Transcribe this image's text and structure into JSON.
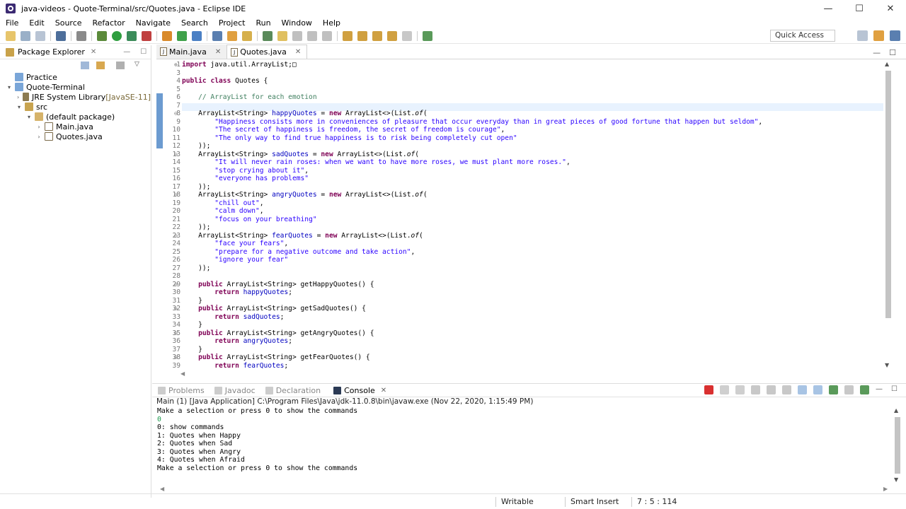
{
  "window": {
    "title": "java-videos - Quote-Terminal/src/Quotes.java - Eclipse IDE",
    "minimize": "—",
    "maximize": "☐",
    "close": "✕"
  },
  "menu": [
    "File",
    "Edit",
    "Source",
    "Refactor",
    "Navigate",
    "Search",
    "Project",
    "Run",
    "Window",
    "Help"
  ],
  "quick_access": "Quick Access",
  "package_explorer": {
    "tab": "Package Explorer",
    "tree": [
      {
        "label": "Practice",
        "indent": 0,
        "icon": "project-icon",
        "arrow": ""
      },
      {
        "label": "Quote-Terminal",
        "indent": 0,
        "icon": "project-icon",
        "arrow": "▾"
      },
      {
        "label": "JRE System Library ",
        "suffix": "[JavaSE-11]",
        "indent": 1,
        "icon": "library-icon",
        "arrow": "›"
      },
      {
        "label": "src",
        "indent": 1,
        "icon": "source-folder-icon",
        "arrow": "▾"
      },
      {
        "label": "(default package)",
        "indent": 2,
        "icon": "package-icon",
        "arrow": "▾"
      },
      {
        "label": "Main.java",
        "indent": 3,
        "icon": "java-file-icon",
        "arrow": "›"
      },
      {
        "label": "Quotes.java",
        "indent": 3,
        "icon": "java-file-icon",
        "arrow": "›"
      }
    ]
  },
  "editor": {
    "tabs": [
      {
        "label": "Main.java",
        "active": false
      },
      {
        "label": "Quotes.java",
        "active": true
      }
    ],
    "lines": [
      {
        "n": "1",
        "fold": "⊕",
        "html": "<span class=\"kw\">import</span> java.util.ArrayList;&#9633;"
      },
      {
        "n": "3",
        "fold": "",
        "html": ""
      },
      {
        "n": "4",
        "fold": "",
        "html": "<span class=\"kw\">public</span> <span class=\"kw\">class</span> Quotes {"
      },
      {
        "n": "5",
        "fold": "",
        "html": ""
      },
      {
        "n": "6",
        "fold": "",
        "html": "    <span class=\"cm\">// ArrayList for each emotion</span>"
      },
      {
        "n": "7",
        "fold": "",
        "html": ""
      },
      {
        "n": "8",
        "fold": "⊖",
        "html": "    ArrayList&lt;String&gt; <span class=\"fld\">happyQuotes</span> = <span class=\"kw\">new</span> ArrayList&lt;&gt;(List.<span class=\"ital\">of</span>("
      },
      {
        "n": "9",
        "fold": "",
        "html": "        <span class=\"str\">\"Happiness consists more in conveniences of pleasure that occur everyday than in great pieces of good fortune that happen but seldom\"</span>,"
      },
      {
        "n": "10",
        "fold": "",
        "html": "        <span class=\"str\">\"The secret of happiness is freedom, the secret of freedom is courage\"</span>,"
      },
      {
        "n": "11",
        "fold": "",
        "html": "        <span class=\"str\">\"The only way to find true happiness is to risk being completely cut open\"</span>"
      },
      {
        "n": "12",
        "fold": "",
        "html": "    ));"
      },
      {
        "n": "13",
        "fold": "⊖",
        "html": "    ArrayList&lt;String&gt; <span class=\"fld\">sadQuotes</span> = <span class=\"kw\">new</span> ArrayList&lt;&gt;(List.<span class=\"ital\">of</span>("
      },
      {
        "n": "14",
        "fold": "",
        "html": "        <span class=\"str\">\"It will never rain roses: when we want to have more roses, we must plant more roses.\"</span>,"
      },
      {
        "n": "15",
        "fold": "",
        "html": "        <span class=\"str\">\"stop crying about it\"</span>,"
      },
      {
        "n": "16",
        "fold": "",
        "html": "        <span class=\"str\">\"everyone has problems\"</span>"
      },
      {
        "n": "17",
        "fold": "",
        "html": "    ));"
      },
      {
        "n": "18",
        "fold": "⊖",
        "html": "    ArrayList&lt;String&gt; <span class=\"fld\">angryQuotes</span> = <span class=\"kw\">new</span> ArrayList&lt;&gt;(List.<span class=\"ital\">of</span>("
      },
      {
        "n": "19",
        "fold": "",
        "html": "        <span class=\"str\">\"chill out\"</span>,"
      },
      {
        "n": "20",
        "fold": "",
        "html": "        <span class=\"str\">\"calm down\"</span>,"
      },
      {
        "n": "21",
        "fold": "",
        "html": "        <span class=\"str\">\"focus on your breathing\"</span>"
      },
      {
        "n": "22",
        "fold": "",
        "html": "    ));"
      },
      {
        "n": "23",
        "fold": "⊖",
        "html": "    ArrayList&lt;String&gt; <span class=\"fld\">fearQuotes</span> = <span class=\"kw\">new</span> ArrayList&lt;&gt;(List.<span class=\"ital\">of</span>("
      },
      {
        "n": "24",
        "fold": "",
        "html": "        <span class=\"str\">\"face your fears\"</span>,"
      },
      {
        "n": "25",
        "fold": "",
        "html": "        <span class=\"str\">\"prepare for a negative outcome and take action\"</span>,"
      },
      {
        "n": "26",
        "fold": "",
        "html": "        <span class=\"str\">\"ignore your fear\"</span>"
      },
      {
        "n": "27",
        "fold": "",
        "html": "    ));"
      },
      {
        "n": "28",
        "fold": "",
        "html": ""
      },
      {
        "n": "29",
        "fold": "⊖",
        "html": "    <span class=\"kw\">public</span> ArrayList&lt;String&gt; getHappyQuotes() {"
      },
      {
        "n": "30",
        "fold": "",
        "html": "        <span class=\"kw\">return</span> <span class=\"fld\">happyQuotes</span>;"
      },
      {
        "n": "31",
        "fold": "",
        "html": "    }"
      },
      {
        "n": "32",
        "fold": "⊖",
        "html": "    <span class=\"kw\">public</span> ArrayList&lt;String&gt; getSadQuotes() {"
      },
      {
        "n": "33",
        "fold": "",
        "html": "        <span class=\"kw\">return</span> <span class=\"fld\">sadQuotes</span>;"
      },
      {
        "n": "34",
        "fold": "",
        "html": "    }"
      },
      {
        "n": "35",
        "fold": "⊖",
        "html": "    <span class=\"kw\">public</span> ArrayList&lt;String&gt; getAngryQuotes() {"
      },
      {
        "n": "36",
        "fold": "",
        "html": "        <span class=\"kw\">return</span> <span class=\"fld\">angryQuotes</span>;"
      },
      {
        "n": "37",
        "fold": "",
        "html": "    }"
      },
      {
        "n": "38",
        "fold": "⊖",
        "html": "    <span class=\"kw\">public</span> ArrayList&lt;String&gt; getFearQuotes() {"
      },
      {
        "n": "39",
        "fold": "",
        "html": "        <span class=\"kw\">return</span> <span class=\"fld\">fearQuotes</span>;"
      }
    ]
  },
  "bottom_panel": {
    "tabs": [
      {
        "label": "Problems",
        "active": false
      },
      {
        "label": "Javadoc",
        "active": false
      },
      {
        "label": "Declaration",
        "active": false
      },
      {
        "label": "Console",
        "active": true
      }
    ],
    "console_title": "Main (1) [Java Application] C:\\Program Files\\Java\\jdk-11.0.8\\bin\\javaw.exe (Nov 22, 2020, 1:15:49 PM)",
    "output": [
      {
        "text": "Make a selection or press 0 to show the commands",
        "cls": ""
      },
      {
        "text": "0",
        "cls": "green"
      },
      {
        "text": "0: show commands",
        "cls": ""
      },
      {
        "text": "1: Quotes when Happy",
        "cls": ""
      },
      {
        "text": "2: Quotes when Sad",
        "cls": ""
      },
      {
        "text": "3: Quotes when Angry",
        "cls": ""
      },
      {
        "text": "4: Quotes when Afraid",
        "cls": ""
      },
      {
        "text": "Make a selection or press 0 to show the commands",
        "cls": ""
      }
    ]
  },
  "status": {
    "writable": "Writable",
    "insert_mode": "Smart Insert",
    "position": "7 : 5 : 114"
  }
}
